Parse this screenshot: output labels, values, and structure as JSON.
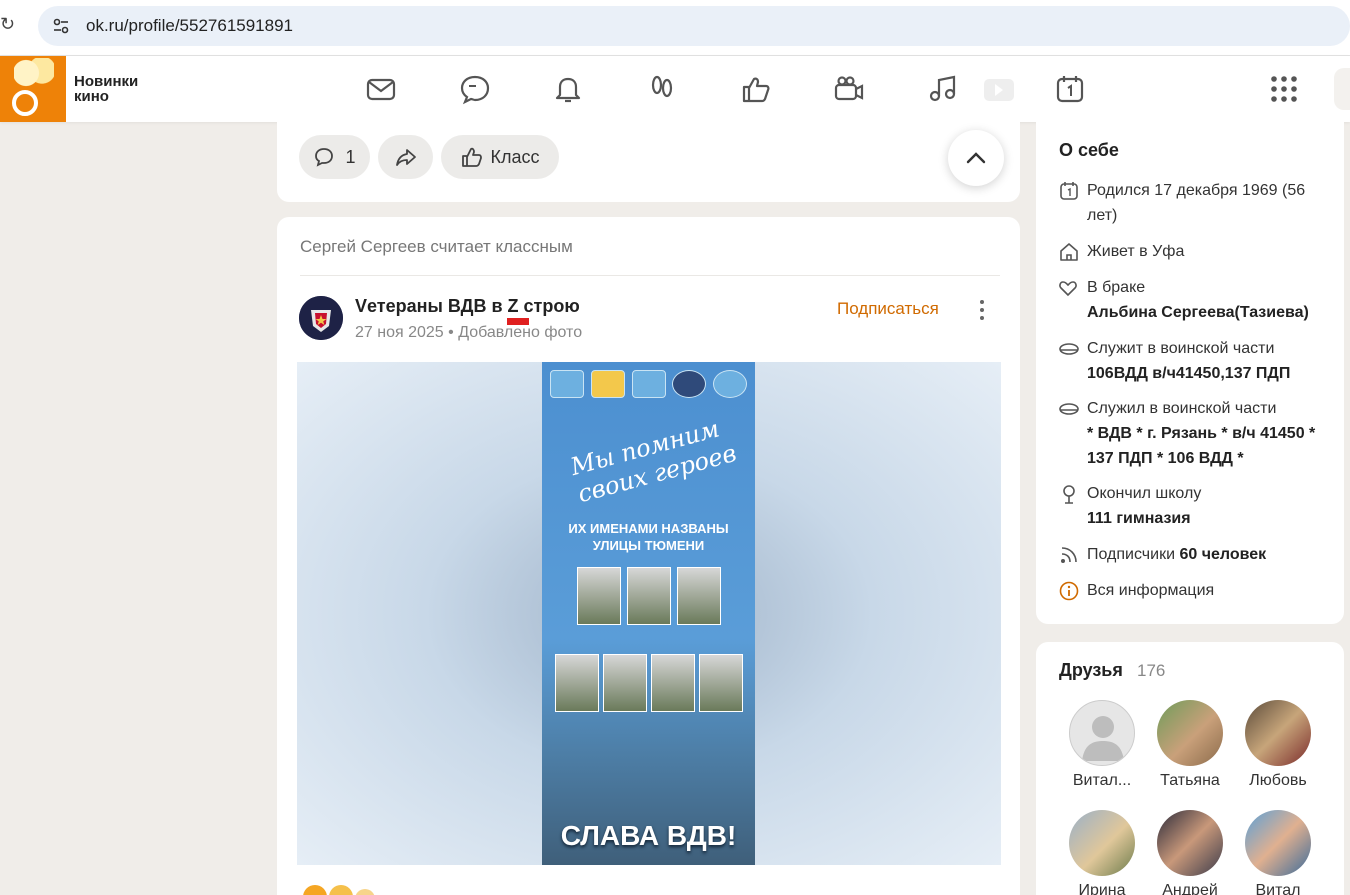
{
  "browser": {
    "url": "ok.ru/profile/552761591891"
  },
  "header": {
    "promo_label_line1": "Новинки",
    "promo_label_line2": "кино",
    "nav_icons": [
      "mail-icon",
      "discussions-icon",
      "notifications-icon",
      "guests-icon",
      "likes-icon",
      "video-icon",
      "music-icon",
      "video-play-icon",
      "calendar-icon",
      "apps-grid-icon"
    ]
  },
  "previous_post": {
    "comments_count": "1",
    "class_label": "Класс"
  },
  "post": {
    "liked_by_line": "Сергей Сергеев считает классным",
    "group_name": "Vетераны ВДВ в Z строю",
    "date": "27 ноя 2025",
    "action": "Добавлено фото",
    "subscribe_label": "Подписаться",
    "poster": {
      "script_line1": "Мы помним",
      "script_line2": "своих героев",
      "subtitle_line1": "ИХ ИМЕНАМИ НАЗВАНЫ",
      "subtitle_line2": "УЛИЦЫ ТЮМЕНИ",
      "slogan": "СЛАВА ВДВ!"
    }
  },
  "about": {
    "title": "О себе",
    "born": "Родился 17 декабря 1969 (56 лет)",
    "lives_prefix": "Живет в ",
    "lives_city": "Уфа",
    "married_label": "В браке",
    "spouse": "Альбина Сергеева(Тазиева)",
    "serving_label": "Служит в воинской части",
    "serving_value": "106ВДД в/ч41450,137 ПДП",
    "served_label": "Служил в воинской части",
    "served_value": "* ВДВ * г. Рязань * в/ч 41450 * 137 ПДП * 106 ВДД *",
    "school_label": "Окончил школу",
    "school_value": "111 гимназия",
    "subscribers_label": "Подписчики",
    "subscribers_value": "60 человек",
    "all_info_label": "Вся информация"
  },
  "friends": {
    "title": "Друзья",
    "count": "176",
    "items": [
      {
        "name": "Витал..."
      },
      {
        "name": "Татьяна"
      },
      {
        "name": "Любовь"
      },
      {
        "name": "Ирина"
      },
      {
        "name": "Андрей"
      },
      {
        "name": "Витал"
      }
    ]
  },
  "colors": {
    "accent_orange": "#ee8208",
    "link_orange": "#d06a00",
    "page_bg": "#f0ede9"
  }
}
